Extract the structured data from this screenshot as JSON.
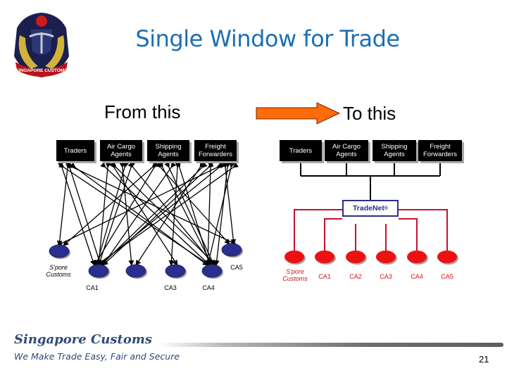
{
  "slide": {
    "title": "Single Window for Trade",
    "page_number": "21"
  },
  "logo": {
    "icon": "singapore-customs-crest",
    "text": "SINGAPORE CUSTOMS"
  },
  "from_panel": {
    "heading": "From this",
    "top_nodes": [
      {
        "label": "Traders"
      },
      {
        "label": "Air Cargo Agents"
      },
      {
        "label": "Shipping Agents"
      },
      {
        "label": "Freight Forwarders"
      }
    ],
    "bottom_nodes": [
      {
        "label": "S'pore Customs"
      },
      {
        "label": "CA1"
      },
      {
        "label": ""
      },
      {
        "label": "CA3"
      },
      {
        "label": "CA4"
      },
      {
        "label": "CA5"
      }
    ],
    "node_color": "#2a2f8f",
    "connection_style": "many-to-many bidirectional arrows"
  },
  "transition_arrow": {
    "icon": "right-arrow-icon",
    "color": "#ff6600"
  },
  "to_panel": {
    "heading": "To this",
    "top_nodes": [
      {
        "label": "Traders"
      },
      {
        "label": "Air Cargo Agents"
      },
      {
        "label": "Shipping Agents"
      },
      {
        "label": "Freight Forwarders"
      }
    ],
    "hub": {
      "label": "TradeNet",
      "mark": "®"
    },
    "bottom_nodes": [
      {
        "label": "S'pore Customs"
      },
      {
        "label": "CA1"
      },
      {
        "label": "CA2"
      },
      {
        "label": "CA3"
      },
      {
        "label": "CA4"
      },
      {
        "label": "CA5"
      }
    ],
    "node_color": "#ee1111",
    "connector_color": "#c8102e"
  },
  "footer": {
    "organization": "Singapore Customs",
    "tagline": "We Make Trade Easy, Fair and Secure"
  }
}
